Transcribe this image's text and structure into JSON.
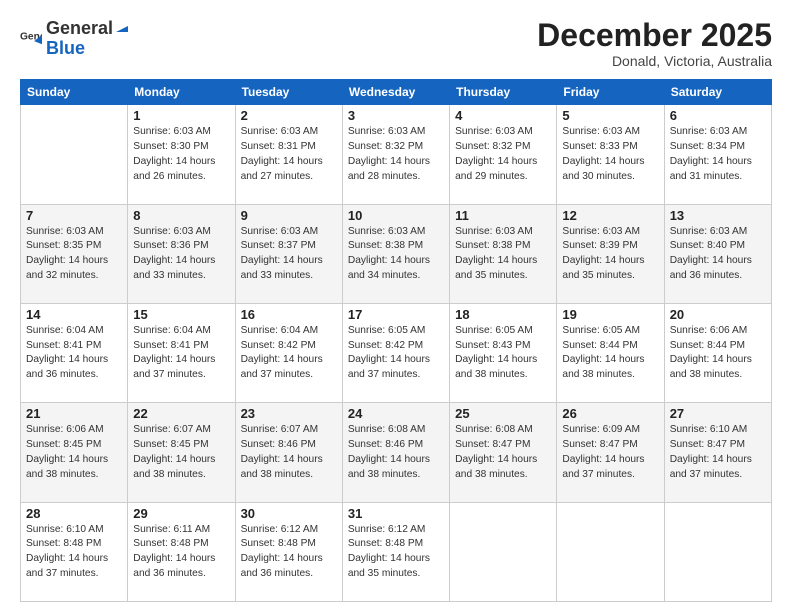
{
  "header": {
    "logo_general": "General",
    "logo_blue": "Blue",
    "title": "December 2025",
    "subtitle": "Donald, Victoria, Australia"
  },
  "columns": [
    "Sunday",
    "Monday",
    "Tuesday",
    "Wednesday",
    "Thursday",
    "Friday",
    "Saturday"
  ],
  "weeks": [
    [
      {
        "day": "",
        "info": ""
      },
      {
        "day": "1",
        "info": "Sunrise: 6:03 AM\nSunset: 8:30 PM\nDaylight: 14 hours\nand 26 minutes."
      },
      {
        "day": "2",
        "info": "Sunrise: 6:03 AM\nSunset: 8:31 PM\nDaylight: 14 hours\nand 27 minutes."
      },
      {
        "day": "3",
        "info": "Sunrise: 6:03 AM\nSunset: 8:32 PM\nDaylight: 14 hours\nand 28 minutes."
      },
      {
        "day": "4",
        "info": "Sunrise: 6:03 AM\nSunset: 8:32 PM\nDaylight: 14 hours\nand 29 minutes."
      },
      {
        "day": "5",
        "info": "Sunrise: 6:03 AM\nSunset: 8:33 PM\nDaylight: 14 hours\nand 30 minutes."
      },
      {
        "day": "6",
        "info": "Sunrise: 6:03 AM\nSunset: 8:34 PM\nDaylight: 14 hours\nand 31 minutes."
      }
    ],
    [
      {
        "day": "7",
        "info": "Sunrise: 6:03 AM\nSunset: 8:35 PM\nDaylight: 14 hours\nand 32 minutes."
      },
      {
        "day": "8",
        "info": "Sunrise: 6:03 AM\nSunset: 8:36 PM\nDaylight: 14 hours\nand 33 minutes."
      },
      {
        "day": "9",
        "info": "Sunrise: 6:03 AM\nSunset: 8:37 PM\nDaylight: 14 hours\nand 33 minutes."
      },
      {
        "day": "10",
        "info": "Sunrise: 6:03 AM\nSunset: 8:38 PM\nDaylight: 14 hours\nand 34 minutes."
      },
      {
        "day": "11",
        "info": "Sunrise: 6:03 AM\nSunset: 8:38 PM\nDaylight: 14 hours\nand 35 minutes."
      },
      {
        "day": "12",
        "info": "Sunrise: 6:03 AM\nSunset: 8:39 PM\nDaylight: 14 hours\nand 35 minutes."
      },
      {
        "day": "13",
        "info": "Sunrise: 6:03 AM\nSunset: 8:40 PM\nDaylight: 14 hours\nand 36 minutes."
      }
    ],
    [
      {
        "day": "14",
        "info": "Sunrise: 6:04 AM\nSunset: 8:41 PM\nDaylight: 14 hours\nand 36 minutes."
      },
      {
        "day": "15",
        "info": "Sunrise: 6:04 AM\nSunset: 8:41 PM\nDaylight: 14 hours\nand 37 minutes."
      },
      {
        "day": "16",
        "info": "Sunrise: 6:04 AM\nSunset: 8:42 PM\nDaylight: 14 hours\nand 37 minutes."
      },
      {
        "day": "17",
        "info": "Sunrise: 6:05 AM\nSunset: 8:42 PM\nDaylight: 14 hours\nand 37 minutes."
      },
      {
        "day": "18",
        "info": "Sunrise: 6:05 AM\nSunset: 8:43 PM\nDaylight: 14 hours\nand 38 minutes."
      },
      {
        "day": "19",
        "info": "Sunrise: 6:05 AM\nSunset: 8:44 PM\nDaylight: 14 hours\nand 38 minutes."
      },
      {
        "day": "20",
        "info": "Sunrise: 6:06 AM\nSunset: 8:44 PM\nDaylight: 14 hours\nand 38 minutes."
      }
    ],
    [
      {
        "day": "21",
        "info": "Sunrise: 6:06 AM\nSunset: 8:45 PM\nDaylight: 14 hours\nand 38 minutes."
      },
      {
        "day": "22",
        "info": "Sunrise: 6:07 AM\nSunset: 8:45 PM\nDaylight: 14 hours\nand 38 minutes."
      },
      {
        "day": "23",
        "info": "Sunrise: 6:07 AM\nSunset: 8:46 PM\nDaylight: 14 hours\nand 38 minutes."
      },
      {
        "day": "24",
        "info": "Sunrise: 6:08 AM\nSunset: 8:46 PM\nDaylight: 14 hours\nand 38 minutes."
      },
      {
        "day": "25",
        "info": "Sunrise: 6:08 AM\nSunset: 8:47 PM\nDaylight: 14 hours\nand 38 minutes."
      },
      {
        "day": "26",
        "info": "Sunrise: 6:09 AM\nSunset: 8:47 PM\nDaylight: 14 hours\nand 37 minutes."
      },
      {
        "day": "27",
        "info": "Sunrise: 6:10 AM\nSunset: 8:47 PM\nDaylight: 14 hours\nand 37 minutes."
      }
    ],
    [
      {
        "day": "28",
        "info": "Sunrise: 6:10 AM\nSunset: 8:48 PM\nDaylight: 14 hours\nand 37 minutes."
      },
      {
        "day": "29",
        "info": "Sunrise: 6:11 AM\nSunset: 8:48 PM\nDaylight: 14 hours\nand 36 minutes."
      },
      {
        "day": "30",
        "info": "Sunrise: 6:12 AM\nSunset: 8:48 PM\nDaylight: 14 hours\nand 36 minutes."
      },
      {
        "day": "31",
        "info": "Sunrise: 6:12 AM\nSunset: 8:48 PM\nDaylight: 14 hours\nand 35 minutes."
      },
      {
        "day": "",
        "info": ""
      },
      {
        "day": "",
        "info": ""
      },
      {
        "day": "",
        "info": ""
      }
    ]
  ]
}
